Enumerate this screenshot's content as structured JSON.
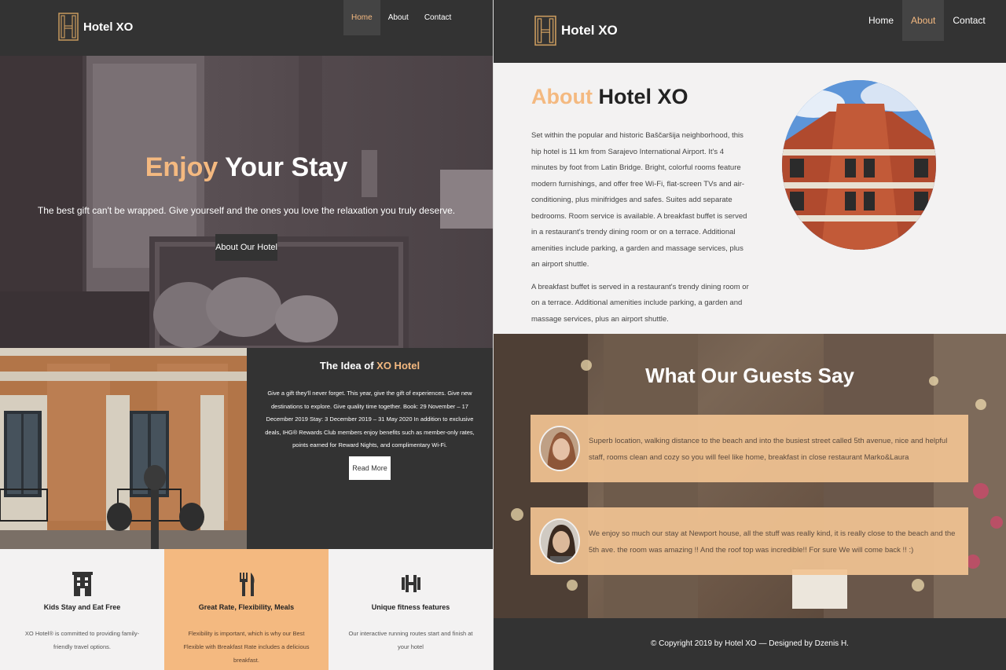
{
  "brand": {
    "name": "Hotel XO"
  },
  "colors": {
    "accent": "#f4b980",
    "dark": "#333333",
    "light": "#f3f2f2"
  },
  "left_page": {
    "nav": [
      {
        "label": "Home",
        "active": true
      },
      {
        "label": "About",
        "active": false
      },
      {
        "label": "Contact",
        "active": false
      }
    ],
    "hero": {
      "title_accent": "Enjoy",
      "title_rest": " Your Stay",
      "subtitle": "The best gift can't be wrapped. Give yourself and the ones you love the relaxation you truly deserve.",
      "button": "About Our Hotel"
    },
    "idea": {
      "title_prefix": "The Idea of ",
      "title_accent": "XO Hotel",
      "text": "Give a gift they'll never forget. This year, give the gift of experiences. Give new destinations to explore. Give quality time together. Book: 29 November – 17 December 2019 Stay: 3 December 2019 – 31 May 2020 In addition to exclusive deals, IHG® Rewards Club members enjoy benefits such as member-only rates, points earned for Reward Nights, and complimentary Wi-Fi.",
      "button": "Read More"
    },
    "features": [
      {
        "icon": "hotel-building-icon",
        "title": "Kids Stay and Eat Free",
        "text": "XO Hotel® is committed to providing family-friendly travel options."
      },
      {
        "icon": "fork-knife-icon",
        "title": "Great Rate, Flexibility, Meals",
        "text": "Flexibility is important, which is why our Best Flexible with Breakfast Rate includes a delicious breakfast."
      },
      {
        "icon": "dumbbell-icon",
        "title": "Unique fitness features",
        "text": "Our interactive running routes start and finish at your hotel"
      }
    ]
  },
  "right_page": {
    "nav": [
      {
        "label": "Home",
        "active": false
      },
      {
        "label": "About",
        "active": true
      },
      {
        "label": "Contact",
        "active": false
      }
    ],
    "about": {
      "title_accent": "About",
      "title_rest": " Hotel XO",
      "para1": "Set within the popular and historic Baščaršija neighborhood, this hip hotel is 11 km from Sarajevo International Airport. It's 4 minutes by foot from Latin Bridge. Bright, colorful rooms feature modern furnishings, and offer free Wi-Fi, flat-screen TVs and air-conditioning, plus minifridges and safes. Suites add separate bedrooms. Room service is available. A breakfast buffet is served in a restaurant's trendy dining room or on a terrace. Additional amenities include parking, a garden and massage services, plus an airport shuttle.",
      "para2": "A breakfast buffet is served in a restaurant's trendy dining room or on a terrace. Additional amenities include parking, a garden and massage services, plus an airport shuttle."
    },
    "testimonials": {
      "title": "What Our Guests Say",
      "items": [
        {
          "text": "Superb location, walking distance to the beach and into the busiest street called 5th avenue, nice and helpful staff, rooms clean and cozy so you will feel like home, breakfast in close restaurant Marko&Laura"
        },
        {
          "text": "We enjoy so much our stay at Newport house, all the stuff was really kind, it is really close to the beach and the 5th ave. the room was amazing !! And the roof top was incredible!! For sure We will come back !! :)"
        }
      ]
    },
    "footer": "© Copyright 2019 by Hotel XO  —  Designed by Dzenis H."
  }
}
